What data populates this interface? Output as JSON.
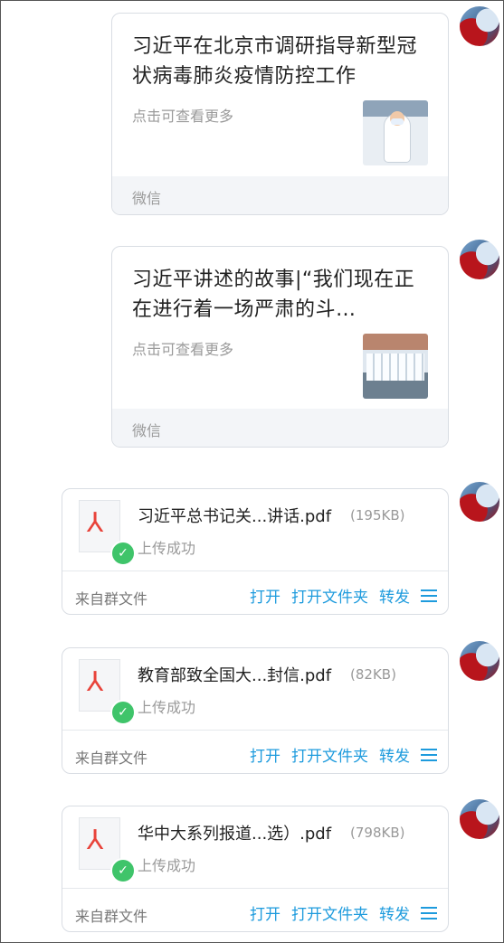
{
  "messages": [
    {
      "type": "article",
      "title": "习近平在北京市调研指导新型冠状病毒肺炎疫情防控工作",
      "desc": "点击可查看更多",
      "source": "微信"
    },
    {
      "type": "article",
      "title": "习近平讲述的故事|“我们现在正在进行着一场严肃的斗…",
      "desc": "点击可查看更多",
      "source": "微信"
    },
    {
      "type": "file",
      "name": "习近平总书记关...讲话.pdf",
      "size": "(195KB)",
      "status": "上传成功",
      "source": "来自群文件",
      "actions": [
        "打开",
        "打开文件夹",
        "转发"
      ]
    },
    {
      "type": "file",
      "name": "教育部致全国大...封信.pdf",
      "size": "(82KB)",
      "status": "上传成功",
      "source": "来自群文件",
      "actions": [
        "打开",
        "打开文件夹",
        "转发"
      ]
    },
    {
      "type": "file",
      "name": "华中大系列报道...选）.pdf",
      "size": "(798KB)",
      "status": "上传成功",
      "source": "来自群文件",
      "actions": [
        "打开",
        "打开文件夹",
        "转发"
      ]
    }
  ],
  "colors": {
    "link": "#1e9bdd",
    "success": "#3fc46a",
    "pdf": "#e8433a"
  },
  "icons": {
    "file_icon": "pdf-icon",
    "status_icon": "check-icon",
    "menu_icon": "hamburger-menu-icon"
  }
}
